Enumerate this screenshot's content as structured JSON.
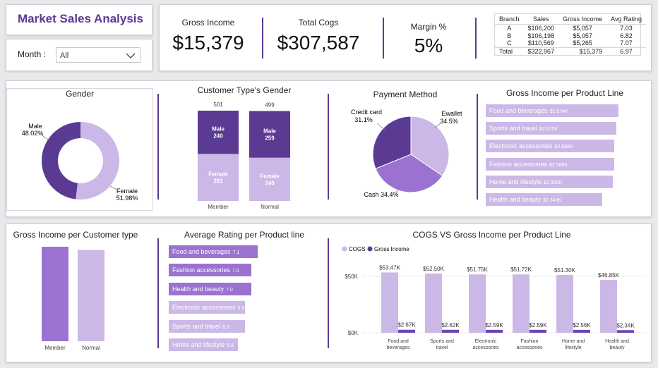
{
  "header": {
    "title": "Market Sales Analysis"
  },
  "filter": {
    "label": "Month :",
    "value": "All"
  },
  "kpis": {
    "gross_income_label": "Gross Income",
    "gross_income_value": "$15,379",
    "total_cogs_label": "Total Cogs",
    "total_cogs_value": "$307,587",
    "margin_label": "Margin %",
    "margin_value": "5%"
  },
  "branch_table": {
    "headers": [
      "Branch",
      "Sales",
      "Gross Income",
      "Avg Rating"
    ],
    "rows": [
      [
        "A",
        "$106,200",
        "$5,057",
        "7.03"
      ],
      [
        "B",
        "$106,198",
        "$5,057",
        "6.82"
      ],
      [
        "C",
        "$110,569",
        "$5,265",
        "7.07"
      ]
    ],
    "total": [
      "Total",
      "$322,967",
      "$15,379",
      "6.97"
    ]
  },
  "colors": {
    "dark": "#5b3a94",
    "mid": "#9b72cf",
    "light": "#cbb8e6",
    "accent": "#6b46b3"
  },
  "chart_data": [
    {
      "type": "pie",
      "variant": "donut",
      "title": "Gender",
      "slices": [
        {
          "label": "Male",
          "value": 48.02,
          "display": "48.02%"
        },
        {
          "label": "Female",
          "value": 51.98,
          "display": "51.98%"
        }
      ]
    },
    {
      "type": "bar",
      "variant": "stacked",
      "title": "Customer Type's Gender",
      "categories": [
        "Member",
        "Normal"
      ],
      "totals": [
        501,
        499
      ],
      "series": [
        {
          "name": "Male",
          "values": [
            240,
            259
          ]
        },
        {
          "name": "Female",
          "values": [
            261,
            240
          ]
        }
      ]
    },
    {
      "type": "pie",
      "title": "Payment Method",
      "slices": [
        {
          "label": "Ewallet",
          "value": 34.5,
          "display": "34.5%"
        },
        {
          "label": "Cash",
          "value": 34.4,
          "display": "34.4%"
        },
        {
          "label": "Credit card",
          "value": 31.1,
          "display": "31.1%"
        }
      ]
    },
    {
      "type": "bar",
      "variant": "horizontal",
      "title": "Gross Income per Product Line",
      "categories": [
        "Food and beverages",
        "Sports and travel",
        "Electronic accessories",
        "Fashion accessories",
        "Home and lifestyle",
        "Health and beauty"
      ],
      "values": [
        2674,
        2625,
        2588,
        2586,
        2565,
        2343
      ],
      "labels": [
        "$2.674K",
        "$2.625K",
        "$2.588K",
        "$2.586K",
        "$2.565K",
        "$2.343K"
      ]
    },
    {
      "type": "bar",
      "title": "Gross Income per Customer type",
      "categories": [
        "Member",
        "Normal"
      ],
      "values": [
        7820,
        7559
      ]
    },
    {
      "type": "bar",
      "variant": "horizontal",
      "title": "Average Rating per Product line",
      "categories": [
        "Food and beverages",
        "Fashion accessories",
        "Health and beauty",
        "Electronic accessories",
        "Sports and travel",
        "Home and lifestyle"
      ],
      "values": [
        7.1,
        7.0,
        7.0,
        6.9,
        6.9,
        6.8
      ],
      "labels": [
        "7.1",
        "7.0",
        "7.0",
        "6.9",
        "6.9",
        "6.8"
      ]
    },
    {
      "type": "bar",
      "variant": "grouped",
      "title": "COGS VS Gross Income per Product Line",
      "categories": [
        "Food and beverages",
        "Sports and travel",
        "Electronic accessories",
        "Fashion accessories",
        "Home and lifestyle",
        "Health and beauty"
      ],
      "category_lines": [
        [
          "Food and",
          "beverages"
        ],
        [
          "Sports and",
          "travel"
        ],
        [
          "Electronic",
          "accessories"
        ],
        [
          "Fashion",
          "accessories"
        ],
        [
          "Home and",
          "lifestyle"
        ],
        [
          "Health and",
          "beauty"
        ]
      ],
      "series": [
        {
          "name": "COGS",
          "values": [
            53470,
            52500,
            51750,
            51720,
            51300,
            46850
          ],
          "labels": [
            "$53.47K",
            "$52.50K",
            "$51.75K",
            "$51.72K",
            "$51.30K",
            "$46.85K"
          ]
        },
        {
          "name": "Gross Income",
          "values": [
            2670,
            2620,
            2590,
            2590,
            2560,
            2340
          ],
          "labels": [
            "$2.67K",
            "$2.62K",
            "$2.59K",
            "$2.59K",
            "$2.56K",
            "$2.34K"
          ]
        }
      ],
      "yticks": [
        {
          "value": 0,
          "label": "$0K"
        },
        {
          "value": 50000,
          "label": "$50K"
        }
      ],
      "legend": "top-left"
    }
  ]
}
